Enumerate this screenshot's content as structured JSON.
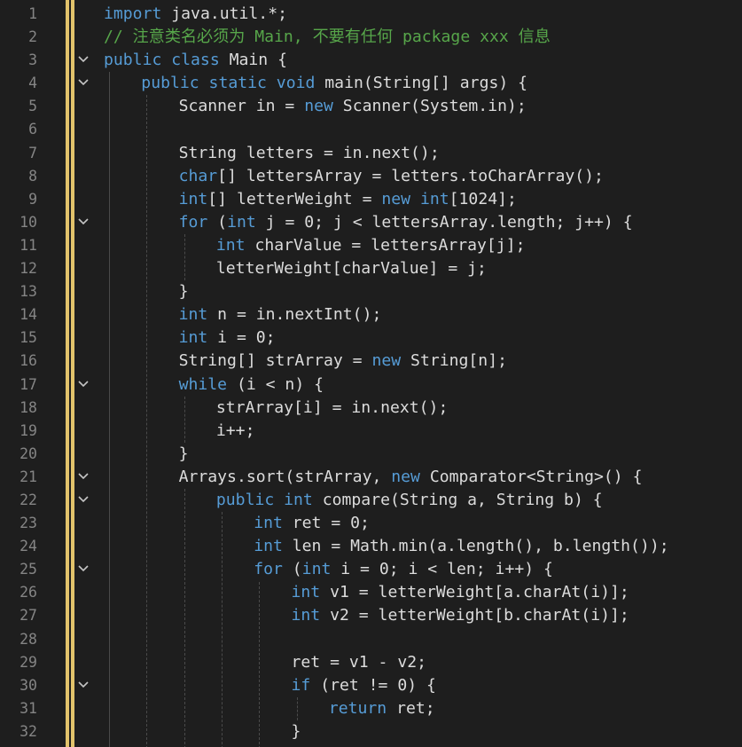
{
  "editor": {
    "colors": {
      "background": "#1e1e1e",
      "line_number": "#858585",
      "keyword": "#569cd6",
      "comment": "#57a64a",
      "text": "#dcdcdc",
      "change_margin": "#e2c36b"
    },
    "lines": [
      {
        "n": "1",
        "indent": 0,
        "fold": false,
        "tokens": [
          {
            "t": "import",
            "c": "kw"
          },
          {
            "t": " java.util.*;",
            "c": "id"
          }
        ]
      },
      {
        "n": "2",
        "indent": 0,
        "fold": false,
        "tokens": [
          {
            "t": "// 注意类名必须为 Main, 不要有任何 package xxx 信息",
            "c": "cm"
          }
        ]
      },
      {
        "n": "3",
        "indent": 0,
        "fold": true,
        "tokens": [
          {
            "t": "public class",
            "c": "kw"
          },
          {
            "t": " Main {",
            "c": "id"
          }
        ]
      },
      {
        "n": "4",
        "indent": 1,
        "fold": true,
        "tokens": [
          {
            "t": "public static void",
            "c": "kw"
          },
          {
            "t": " main(String[] args) {",
            "c": "id"
          }
        ]
      },
      {
        "n": "5",
        "indent": 2,
        "fold": false,
        "tokens": [
          {
            "t": "Scanner in = ",
            "c": "id"
          },
          {
            "t": "new",
            "c": "kw"
          },
          {
            "t": " Scanner(System.in);",
            "c": "id"
          }
        ]
      },
      {
        "n": "6",
        "indent": 2,
        "fold": false,
        "tokens": []
      },
      {
        "n": "7",
        "indent": 2,
        "fold": false,
        "tokens": [
          {
            "t": "String letters = in.next();",
            "c": "id"
          }
        ]
      },
      {
        "n": "8",
        "indent": 2,
        "fold": false,
        "tokens": [
          {
            "t": "char",
            "c": "kw"
          },
          {
            "t": "[] lettersArray = letters.toCharArray();",
            "c": "id"
          }
        ]
      },
      {
        "n": "9",
        "indent": 2,
        "fold": false,
        "tokens": [
          {
            "t": "int",
            "c": "kw"
          },
          {
            "t": "[] letterWeight = ",
            "c": "id"
          },
          {
            "t": "new int",
            "c": "kw"
          },
          {
            "t": "[1024];",
            "c": "id"
          }
        ]
      },
      {
        "n": "10",
        "indent": 2,
        "fold": true,
        "tokens": [
          {
            "t": "for",
            "c": "kw"
          },
          {
            "t": " (",
            "c": "id"
          },
          {
            "t": "int",
            "c": "kw"
          },
          {
            "t": " j = 0; j < lettersArray.length; j++) {",
            "c": "id"
          }
        ]
      },
      {
        "n": "11",
        "indent": 3,
        "fold": false,
        "tokens": [
          {
            "t": "int",
            "c": "kw"
          },
          {
            "t": " charValue = lettersArray[j];",
            "c": "id"
          }
        ]
      },
      {
        "n": "12",
        "indent": 3,
        "fold": false,
        "tokens": [
          {
            "t": "letterWeight[charValue] = j;",
            "c": "id"
          }
        ]
      },
      {
        "n": "13",
        "indent": 2,
        "fold": false,
        "tokens": [
          {
            "t": "}",
            "c": "id"
          }
        ]
      },
      {
        "n": "14",
        "indent": 2,
        "fold": false,
        "tokens": [
          {
            "t": "int",
            "c": "kw"
          },
          {
            "t": " n = in.nextInt();",
            "c": "id"
          }
        ]
      },
      {
        "n": "15",
        "indent": 2,
        "fold": false,
        "tokens": [
          {
            "t": "int",
            "c": "kw"
          },
          {
            "t": " i = 0;",
            "c": "id"
          }
        ]
      },
      {
        "n": "16",
        "indent": 2,
        "fold": false,
        "tokens": [
          {
            "t": "String[] strArray = ",
            "c": "id"
          },
          {
            "t": "new",
            "c": "kw"
          },
          {
            "t": " String[n];",
            "c": "id"
          }
        ]
      },
      {
        "n": "17",
        "indent": 2,
        "fold": true,
        "tokens": [
          {
            "t": "while",
            "c": "kw"
          },
          {
            "t": " (i < n) {",
            "c": "id"
          }
        ]
      },
      {
        "n": "18",
        "indent": 3,
        "fold": false,
        "tokens": [
          {
            "t": "strArray[i] = in.next();",
            "c": "id"
          }
        ]
      },
      {
        "n": "19",
        "indent": 3,
        "fold": false,
        "tokens": [
          {
            "t": "i++;",
            "c": "id"
          }
        ]
      },
      {
        "n": "20",
        "indent": 2,
        "fold": false,
        "tokens": [
          {
            "t": "}",
            "c": "id"
          }
        ]
      },
      {
        "n": "21",
        "indent": 2,
        "fold": true,
        "tokens": [
          {
            "t": "Arrays.sort(strArray, ",
            "c": "id"
          },
          {
            "t": "new",
            "c": "kw"
          },
          {
            "t": " Comparator<String>() {",
            "c": "id"
          }
        ]
      },
      {
        "n": "22",
        "indent": 3,
        "fold": true,
        "tokens": [
          {
            "t": "public int",
            "c": "kw"
          },
          {
            "t": " compare(String a, String b) {",
            "c": "id"
          }
        ]
      },
      {
        "n": "23",
        "indent": 4,
        "fold": false,
        "tokens": [
          {
            "t": "int",
            "c": "kw"
          },
          {
            "t": " ret = 0;",
            "c": "id"
          }
        ]
      },
      {
        "n": "24",
        "indent": 4,
        "fold": false,
        "tokens": [
          {
            "t": "int",
            "c": "kw"
          },
          {
            "t": " len = Math.min(a.length(), b.length());",
            "c": "id"
          }
        ]
      },
      {
        "n": "25",
        "indent": 4,
        "fold": true,
        "tokens": [
          {
            "t": "for",
            "c": "kw"
          },
          {
            "t": " (",
            "c": "id"
          },
          {
            "t": "int",
            "c": "kw"
          },
          {
            "t": " i = 0; i < len; i++) {",
            "c": "id"
          }
        ]
      },
      {
        "n": "26",
        "indent": 5,
        "fold": false,
        "tokens": [
          {
            "t": "int",
            "c": "kw"
          },
          {
            "t": " v1 = letterWeight[a.charAt(i)];",
            "c": "id"
          }
        ]
      },
      {
        "n": "27",
        "indent": 5,
        "fold": false,
        "tokens": [
          {
            "t": "int",
            "c": "kw"
          },
          {
            "t": " v2 = letterWeight[b.charAt(i)];",
            "c": "id"
          }
        ]
      },
      {
        "n": "28",
        "indent": 5,
        "fold": false,
        "tokens": []
      },
      {
        "n": "29",
        "indent": 5,
        "fold": false,
        "tokens": [
          {
            "t": "ret = v1 - v2;",
            "c": "id"
          }
        ]
      },
      {
        "n": "30",
        "indent": 5,
        "fold": true,
        "tokens": [
          {
            "t": "if",
            "c": "kw"
          },
          {
            "t": " (ret != 0) {",
            "c": "id"
          }
        ]
      },
      {
        "n": "31",
        "indent": 6,
        "fold": false,
        "tokens": [
          {
            "t": "return",
            "c": "kw"
          },
          {
            "t": " ret;",
            "c": "id"
          }
        ]
      },
      {
        "n": "32",
        "indent": 5,
        "fold": false,
        "tokens": [
          {
            "t": "}",
            "c": "id"
          }
        ]
      }
    ]
  }
}
